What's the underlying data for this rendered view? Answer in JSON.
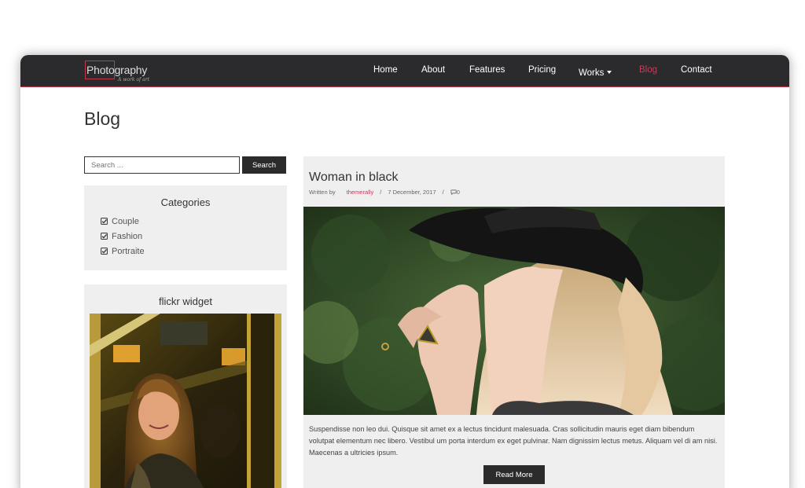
{
  "header": {
    "logo_text": "Photography",
    "logo_tagline": "A work of art",
    "nav": [
      {
        "label": "Home"
      },
      {
        "label": "About"
      },
      {
        "label": "Features"
      },
      {
        "label": "Pricing"
      },
      {
        "label": "Works"
      },
      {
        "label": "Blog",
        "active": true
      },
      {
        "label": "Contact"
      }
    ]
  },
  "page": {
    "title": "Blog"
  },
  "search": {
    "placeholder": "Search ...",
    "button_label": "Search"
  },
  "categories": {
    "title": "Categories",
    "items": [
      "Couple",
      "Fashion",
      "Portraite"
    ]
  },
  "flickr": {
    "title": "flickr widget"
  },
  "post": {
    "title": "Woman in black",
    "written_by_label": "Written by",
    "author": "themerally",
    "sep": "/",
    "date": "7 December, 2017",
    "comments": "0",
    "excerpt": "Suspendisse non leo dui. Quisque sit amet ex a lectus tincidunt malesuada. Cras sollicitudin mauris eget diam bibendum volutpat elementum nec libero. Vestibul um porta interdum ex eget pulvinar. Nam dignissim lectus metus. Aliquam vel di am nisi. Maecenas a ultricies ipsum.",
    "read_more_label": "Read More"
  },
  "colors": {
    "accent": "#c93a5a",
    "navbar": "#2b2b2d",
    "widget_bg": "#efefef",
    "button": "#2b2b2b"
  },
  "icons": {
    "category_check": "check-square-icon",
    "comments": "comment-icon",
    "dropdown": "caret-down-icon"
  }
}
